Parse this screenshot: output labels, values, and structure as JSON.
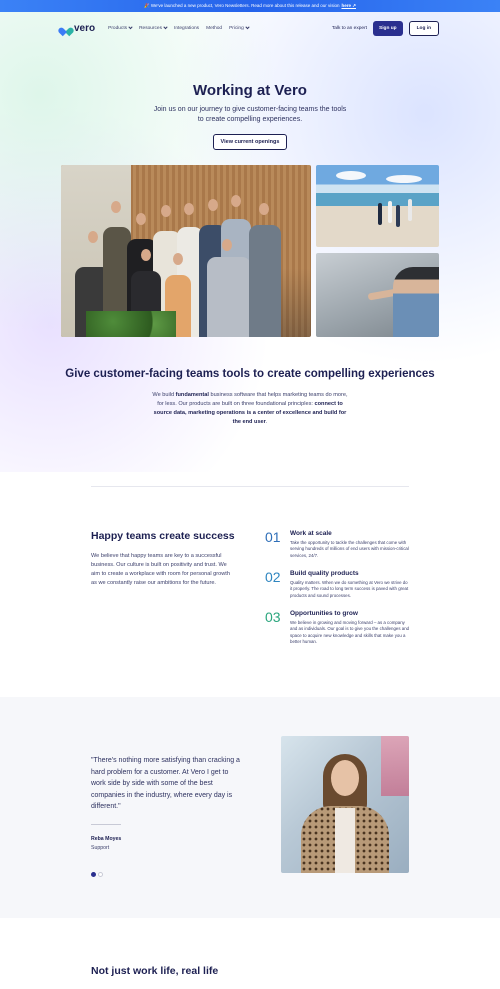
{
  "announcement": {
    "icon": "party-popper-icon",
    "text": "🎉 We've launched a new product, Vero Newsletters. Read more about this release and our vision",
    "link": "here ↗"
  },
  "nav": {
    "brand": "vero",
    "menu": [
      "Products",
      "Resources",
      "Integrations",
      "Method",
      "Pricing"
    ],
    "talk": "Talk to an expert",
    "signup": "Sign up",
    "login": "Log in"
  },
  "hero": {
    "title": "Working at Vero",
    "subtitle": "Join us on our journey to give customer-facing teams the tools to create compelling experiences.",
    "cta": "View current openings"
  },
  "tools": {
    "title": "Give customer-facing teams tools to create compelling experiences",
    "p1": "We build ",
    "p1_bold": "fundamental",
    "p2": " business software that helps marketing teams do more, for less. Our products are built on three foundational principles: ",
    "p2_bold": "connect to source data, marketing operations is a center of excellence and build for the end user",
    "p3": "."
  },
  "happy": {
    "title": "Happy teams create success",
    "body": "We believe that happy teams are key to a successful business. Our culture is built on positivity and trust. We aim to create a workplace with room for personal growth as we constantly raise our ambitions for the future."
  },
  "features": [
    {
      "num": "01",
      "title": "Work at scale",
      "body": "Take the opportunity to tackle the challenges that come with serving hundreds of millions of end users with mission-critical services, 24/7."
    },
    {
      "num": "02",
      "title": "Build quality products",
      "body": "Quality matters. When we do something at Vero we strive do it properly. The road to long term success is paved with great products and sound processes."
    },
    {
      "num": "03",
      "title": "Opportunities to grow",
      "body": "We believe in growing and moving forward – as a company and as individuals. Our goal is to give you the challenges and space to acquire new knowledge and skills that make you a better human."
    }
  ],
  "feature_colors": [
    "#2f6fb8",
    "#2f86c0",
    "#2ba67e"
  ],
  "testimonial": {
    "quote": "\"There's nothing more satisfying than cracking a hard problem for a customer. At Vero I get to work side by side with some of the best companies in the industry, where every day is different.\"",
    "name": "Reba Moyes",
    "role": "Support"
  },
  "bottom": {
    "title": "Not just work life, real life"
  }
}
